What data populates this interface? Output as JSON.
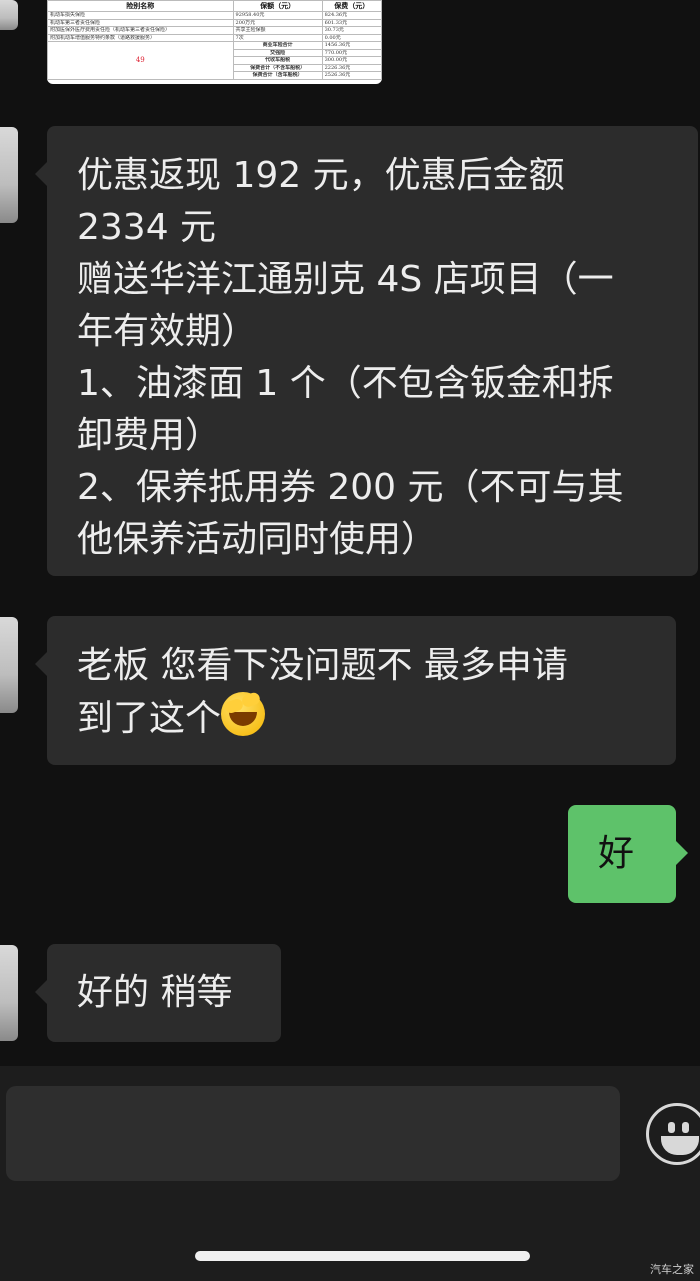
{
  "insurance_image": {
    "headers": [
      "险别名称",
      "保额（元）",
      "保费（元）"
    ],
    "rows": [
      [
        "机动车损失保险",
        "92958.40元",
        "824.36元"
      ],
      [
        "机动车第三者责任保险",
        "200万元",
        "601.33元"
      ],
      [
        "附加医保外医疗费用责任险（机动车第三者责任保险）",
        "共享主险保额",
        "30.73元"
      ],
      [
        "附加机动车增值服务特约条款（道路救援服务）",
        "7次",
        "0.00元"
      ]
    ],
    "red_number": "49",
    "summary": [
      [
        "商业车险合计",
        "1456.36元"
      ],
      [
        "交强险",
        "770.00元"
      ],
      [
        "代收车船税",
        "300.00元"
      ],
      [
        "保费合计（不含车船税）",
        "2226.36元"
      ],
      [
        "保费合计（含车船税）",
        "2526.36元"
      ]
    ]
  },
  "messages": [
    {
      "side": "left",
      "lines": [
        "优惠返现 192 元，优惠后金额",
        "2334 元",
        "赠送华洋江通别克 4S 店项目（一",
        "年有效期）",
        "1、油漆面 1 个（不包含钣金和拆",
        "卸费用）",
        "2、保养抵用券 200 元（不可与其",
        "他保养活动同时使用）"
      ]
    },
    {
      "side": "left",
      "lines": [
        "老板 您看下没问题不  最多申请",
        "到了这个"
      ],
      "emoji": "facepalm-crying-emoji"
    },
    {
      "side": "right",
      "lines": [
        "好"
      ]
    },
    {
      "side": "left",
      "lines": [
        "好的 稍等"
      ]
    }
  ],
  "input": {
    "value": ""
  },
  "watermark": "汽车之家"
}
